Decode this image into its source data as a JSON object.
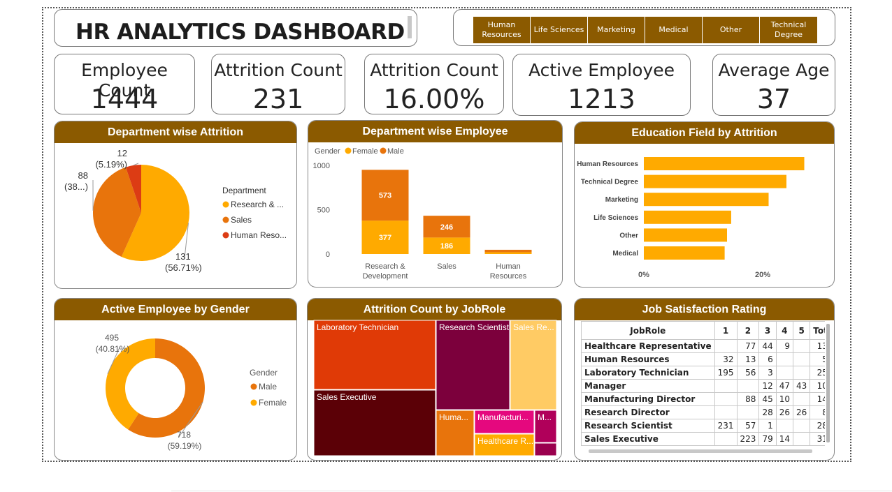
{
  "header": {
    "title": "HR ANALYTICS DASHBOARD"
  },
  "slicer": {
    "items": [
      "Human\nResources",
      "Life Sciences",
      "Marketing",
      "Medical",
      "Other",
      "Technical\nDegree"
    ],
    "color": "#8B5A00"
  },
  "kpis": [
    {
      "label": "Employee Count",
      "value": "1444"
    },
    {
      "label": "Attrition Count",
      "value": "231"
    },
    {
      "label": "Attrition Count",
      "value": "16.00%"
    },
    {
      "label": "Active Employee",
      "value": "1213"
    },
    {
      "label": "Average Age",
      "value": "37"
    }
  ],
  "colors": {
    "header": "#8B5A00",
    "yellow": "#FFAA00",
    "orange": "#E8740C",
    "red": "#DC3C14"
  },
  "chart_data": [
    {
      "type": "pie",
      "title": "Department wise Attrition",
      "legend_title": "Department",
      "legend_position": "right",
      "slices": [
        {
          "name": "Research & ...",
          "value": 131,
          "label_value": "131",
          "label_pct": "(56.71%)",
          "color": "#FFAA00"
        },
        {
          "name": "Sales",
          "value": 88,
          "label_value": "88",
          "label_pct": "(38...)",
          "color": "#E8740C"
        },
        {
          "name": "Human Reso...",
          "value": 12,
          "label_value": "12",
          "label_pct": "(5.19%)",
          "color": "#DC3C14"
        }
      ]
    },
    {
      "type": "bar",
      "stacked": true,
      "title": "Department wise Employee",
      "legend_title": "Gender",
      "legend_position": "top-left",
      "categories": [
        "Research &\nDevelopment",
        "Sales",
        "Human\nResources"
      ],
      "series": [
        {
          "name": "Female",
          "values": [
            377,
            186,
            20
          ],
          "color": "#FFAA00"
        },
        {
          "name": "Male",
          "values": [
            573,
            246,
            28
          ],
          "color": "#E8740C"
        }
      ],
      "ylim": [
        0,
        1000
      ],
      "yticks": [
        "0",
        "500",
        "1000"
      ],
      "data_labels": [
        [
          "377",
          "186",
          ""
        ],
        [
          "573",
          "246",
          ""
        ]
      ]
    },
    {
      "type": "bar",
      "orientation": "horizontal",
      "title": "Education Field by Attrition",
      "categories": [
        "Human Resources",
        "Technical Degree",
        "Marketing",
        "Life Sciences",
        "Other",
        "Medical"
      ],
      "values": [
        0.27,
        0.24,
        0.21,
        0.147,
        0.14,
        0.136
      ],
      "xticks": [
        "0%",
        "20%"
      ],
      "color": "#FFAA00"
    },
    {
      "type": "pie",
      "donut": true,
      "title": "Active Employee by Gender",
      "legend_title": "Gender",
      "legend_position": "right",
      "slices": [
        {
          "name": "Male",
          "value": 718,
          "label_value": "718",
          "label_pct": "(59.19%)",
          "color": "#E8740C"
        },
        {
          "name": "Female",
          "value": 495,
          "label_value": "495",
          "label_pct": "(40.81%)",
          "color": "#FFAA00"
        }
      ]
    },
    {
      "type": "treemap",
      "title": "Attrition Count by JobRole",
      "cells": [
        {
          "label": "Laboratory Technician",
          "color": "#E03A06"
        },
        {
          "label": "Sales Executive",
          "color": "#5B0006"
        },
        {
          "label": "Research Scientist",
          "color": "#7C003C"
        },
        {
          "label": "Sales Re...",
          "color": "#FFCB64"
        },
        {
          "label": "Huma...",
          "color": "#E8740C"
        },
        {
          "label": "Manufacturi...",
          "color": "#E5087E"
        },
        {
          "label": "M...",
          "color": "#B0005A"
        },
        {
          "label": "Healthcare R...",
          "color": "#FFAA00"
        },
        {
          "label": "",
          "color": "#9A004E"
        }
      ]
    },
    {
      "type": "table",
      "title": "Job Satisfaction Rating",
      "columns": [
        "JobRole",
        "1",
        "2",
        "3",
        "4",
        "5",
        "Tot"
      ],
      "rows": [
        [
          "Healthcare Representative",
          "",
          "77",
          "44",
          "9",
          "",
          "13"
        ],
        [
          "Human Resources",
          "32",
          "13",
          "6",
          "",
          "",
          "5"
        ],
        [
          "Laboratory Technician",
          "195",
          "56",
          "3",
          "",
          "",
          "25"
        ],
        [
          "Manager",
          "",
          "",
          "12",
          "47",
          "43",
          "10"
        ],
        [
          "Manufacturing Director",
          "",
          "88",
          "45",
          "10",
          "",
          "14"
        ],
        [
          "Research Director",
          "",
          "",
          "28",
          "26",
          "26",
          "8"
        ],
        [
          "Research Scientist",
          "231",
          "57",
          "1",
          "",
          "",
          "28"
        ],
        [
          "Sales Executive",
          "",
          "223",
          "79",
          "14",
          "",
          "31"
        ]
      ]
    }
  ]
}
